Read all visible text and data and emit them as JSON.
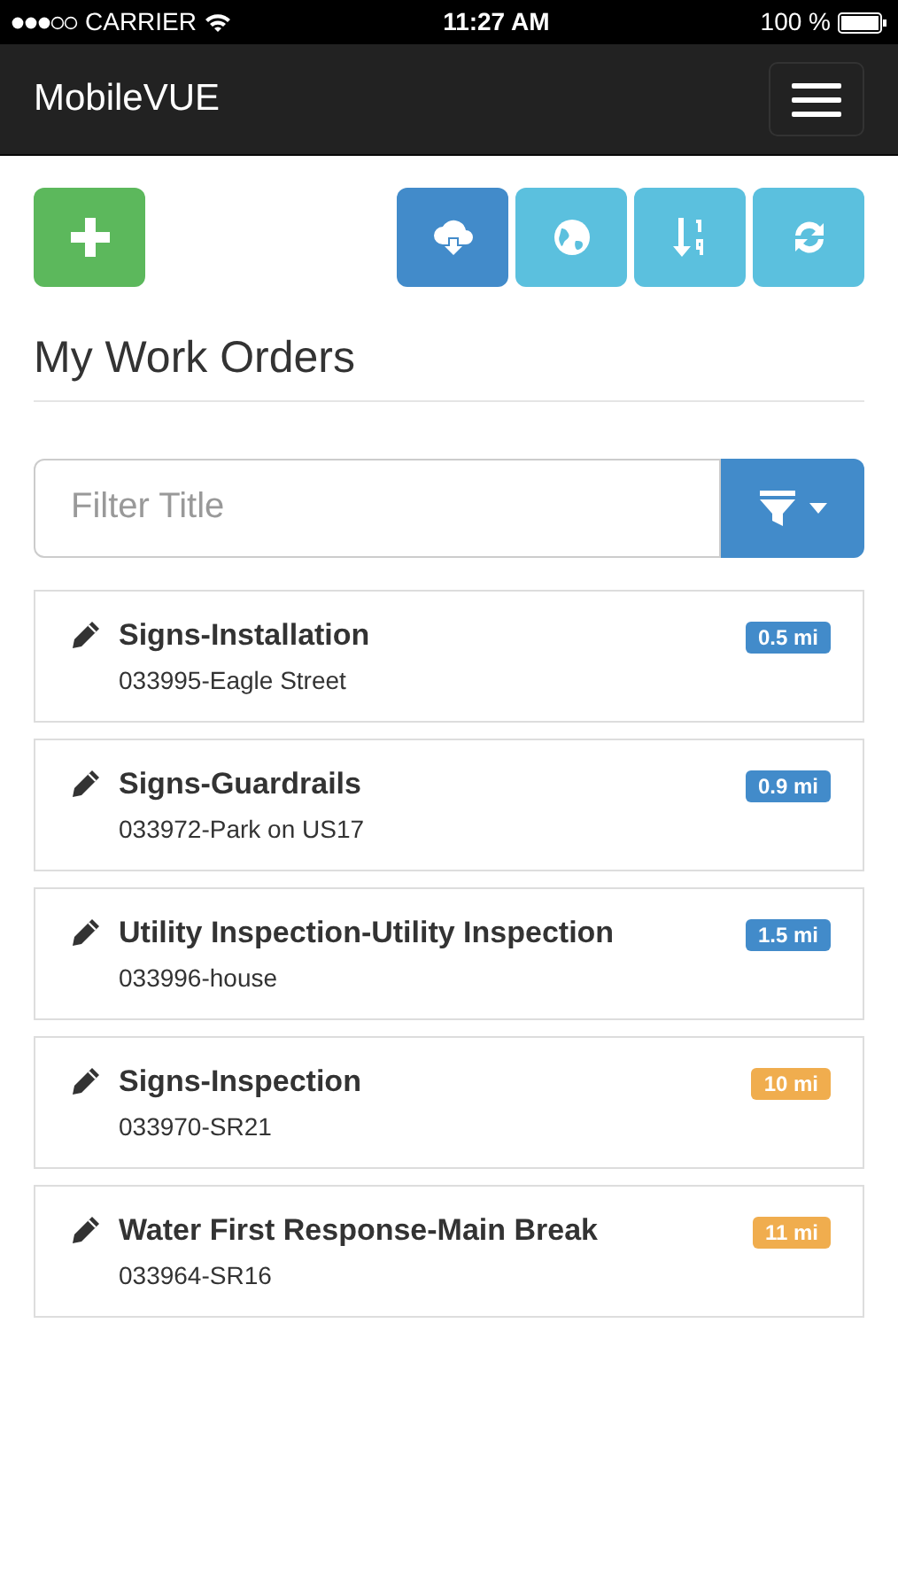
{
  "status_bar": {
    "carrier": "CARRIER",
    "time": "11:27 AM",
    "battery": "100 %"
  },
  "navbar": {
    "brand": "MobileVUE"
  },
  "toolbar": {
    "add_button": {
      "kind": "add"
    },
    "buttons": [
      {
        "kind": "cloud-download",
        "active": true
      },
      {
        "kind": "globe",
        "active": false
      },
      {
        "kind": "sort",
        "active": false
      },
      {
        "kind": "refresh",
        "active": false
      }
    ]
  },
  "heading": "My Work Orders",
  "filter": {
    "placeholder": "Filter Title"
  },
  "work_orders": [
    {
      "title": "Signs-Installation",
      "subtitle": "033995-Eagle Street",
      "distance": "0.5 mi",
      "color": "#428bca"
    },
    {
      "title": "Signs-Guardrails",
      "subtitle": "033972-Park on US17",
      "distance": "0.9 mi",
      "color": "#428bca"
    },
    {
      "title": "Utility Inspection-Utility Inspection",
      "subtitle": "033996-house",
      "distance": "1.5 mi",
      "color": "#428bca"
    },
    {
      "title": "Signs-Inspection",
      "subtitle": "033970-SR21",
      "distance": "10 mi",
      "color": "#f0ad4e"
    },
    {
      "title": "Water First Response-Main Break",
      "subtitle": "033964-SR16",
      "distance": "11 mi",
      "color": "#f0ad4e"
    }
  ]
}
